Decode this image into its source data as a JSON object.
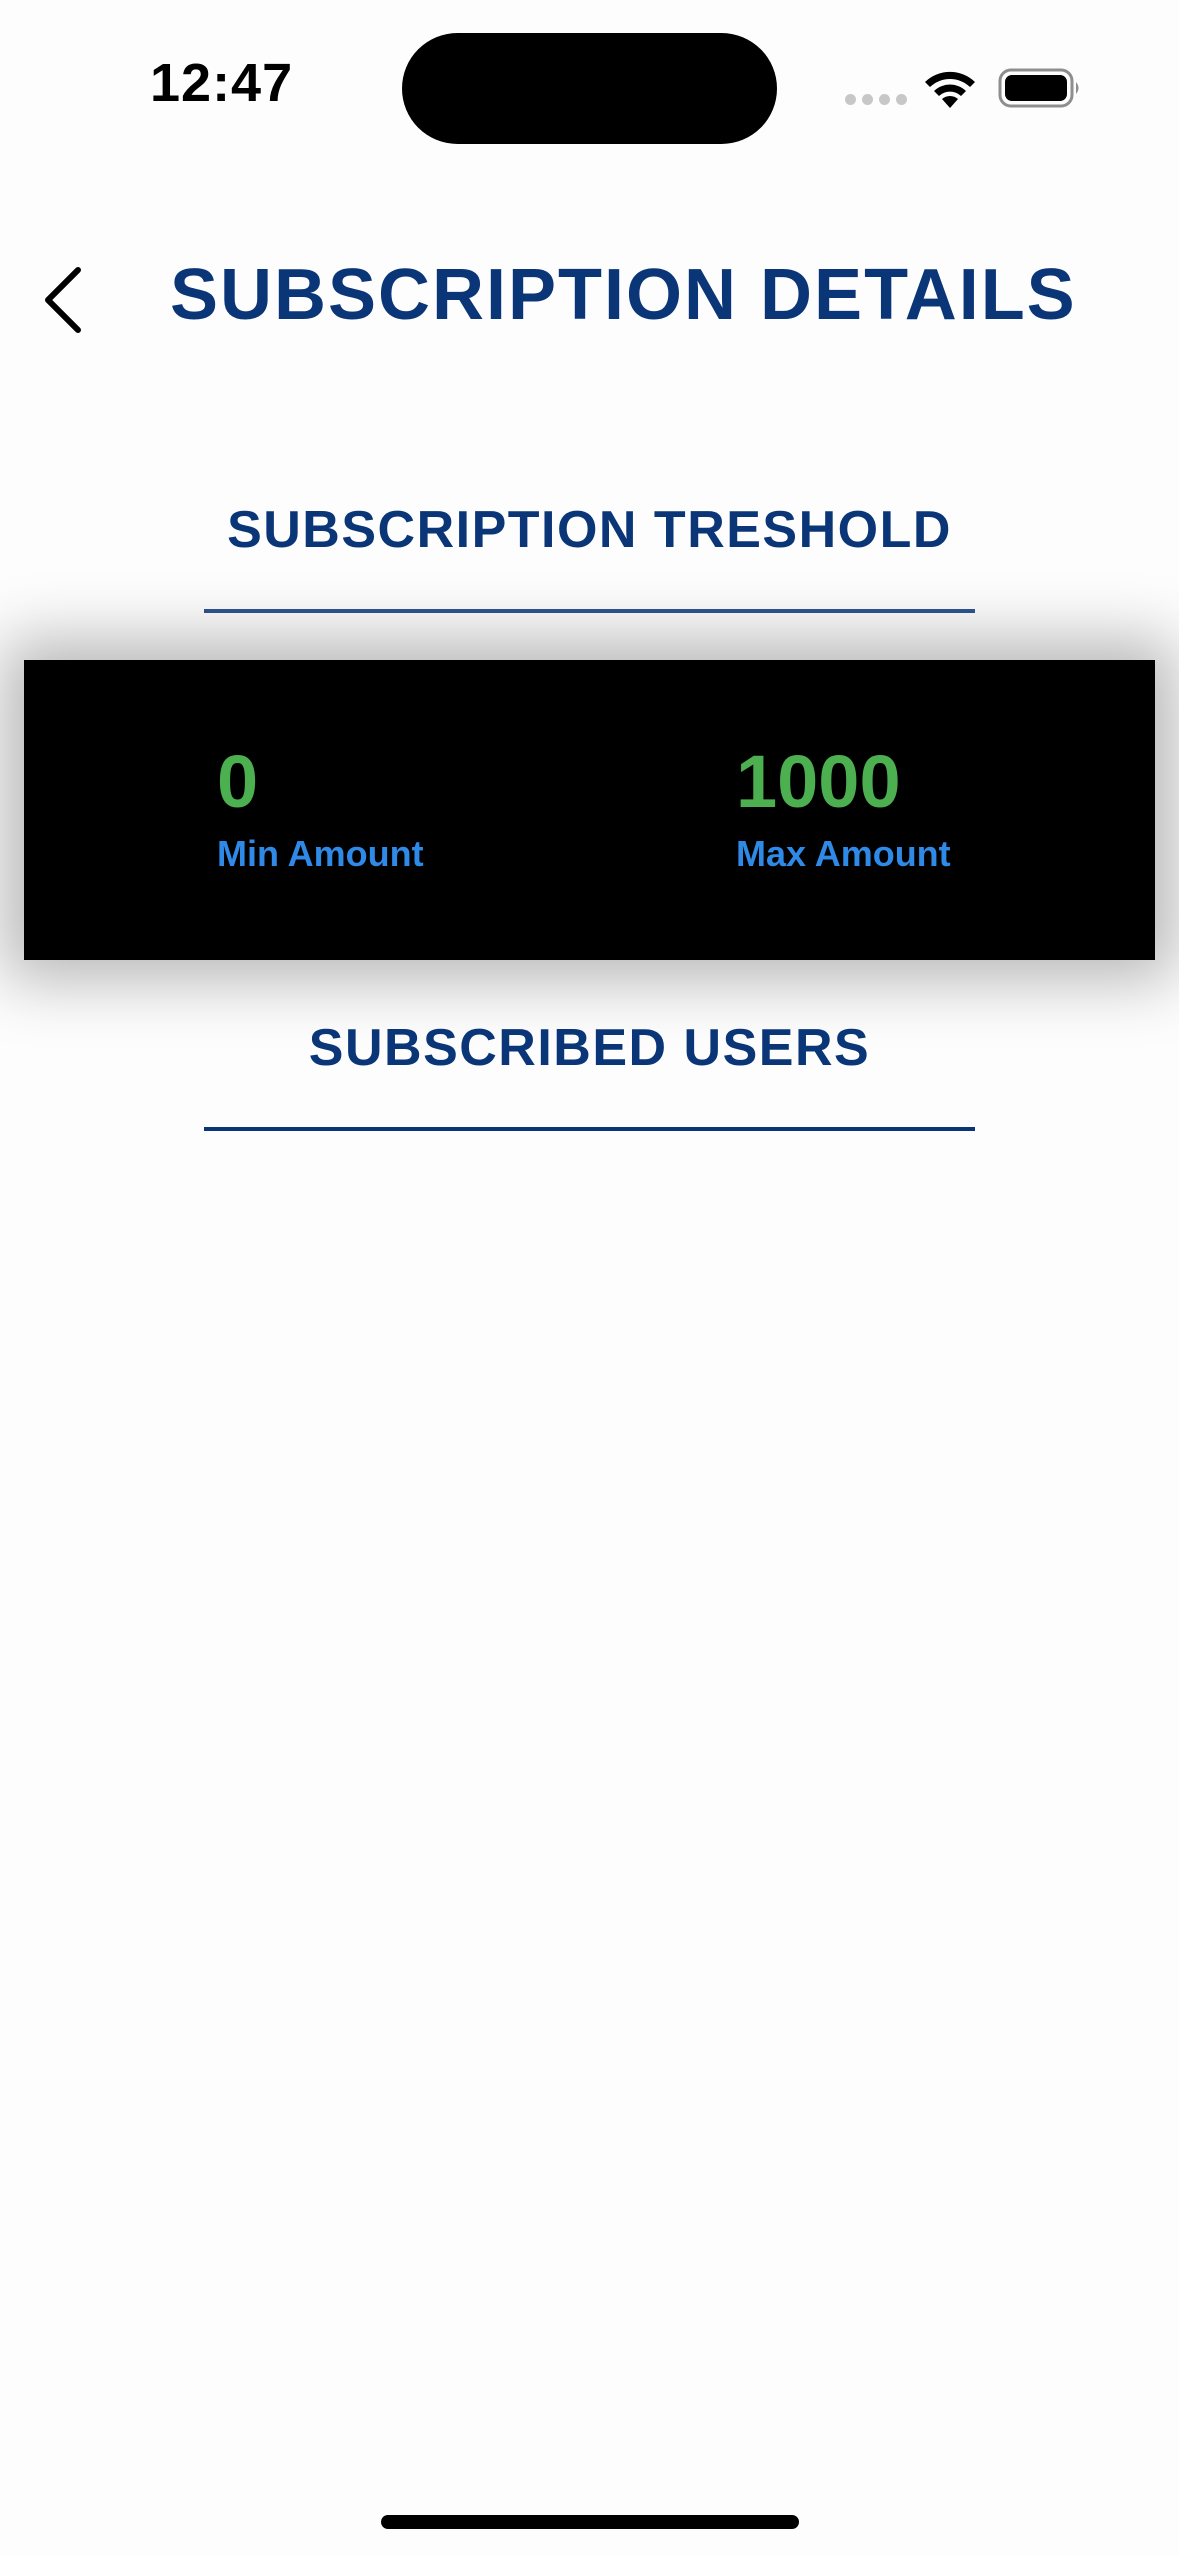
{
  "status_bar": {
    "time": "12:47"
  },
  "header": {
    "back_icon": "chevron-left-icon",
    "title": "SUBSCRIPTION DETAILS"
  },
  "threshold_section": {
    "title": "SUBSCRIPTION TRESHOLD",
    "min": {
      "value": "0",
      "label": "Min Amount"
    },
    "max": {
      "value": "1000",
      "label": "Max Amount"
    }
  },
  "users_section": {
    "title": "SUBSCRIBED USERS",
    "users": []
  },
  "colors": {
    "title": "#0a3678",
    "value": "#4caf50",
    "label": "#2e8ae6",
    "card_background": "#000000"
  }
}
